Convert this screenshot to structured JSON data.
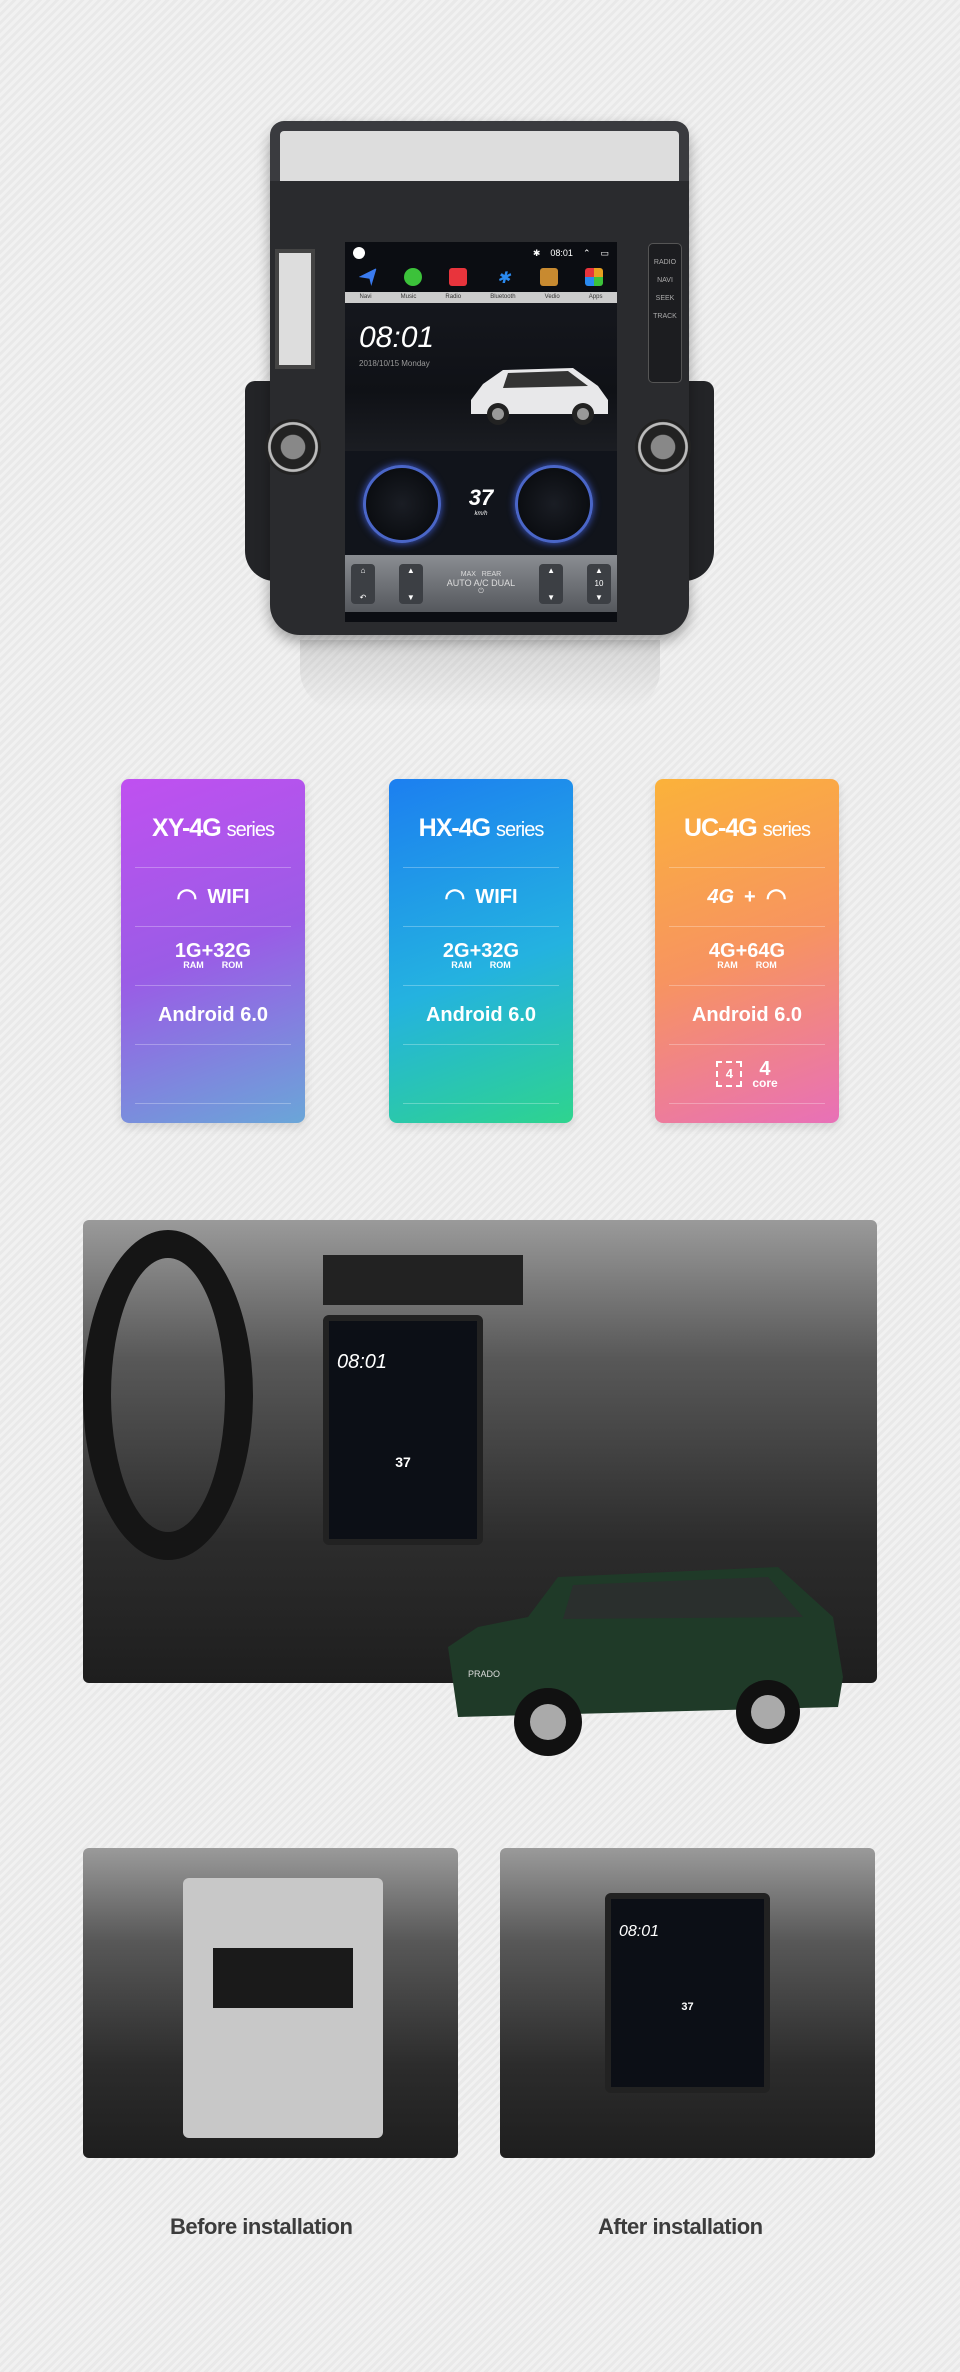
{
  "head_unit": {
    "side_buttons": [
      "RADIO",
      "NAVI",
      "SEEK",
      "TRACK"
    ],
    "status_time": "08:01",
    "apps": [
      {
        "label": "Navi",
        "color": "#3a7bf0"
      },
      {
        "label": "Music",
        "color": "#3cc23a"
      },
      {
        "label": "Radio",
        "color": "#e8343c"
      },
      {
        "label": "Bluetooth",
        "color": "#2a8af0"
      },
      {
        "label": "Vedio",
        "color": "#c88a30"
      },
      {
        "label": "Apps",
        "color": "#e8a020"
      }
    ],
    "clock": "08:01",
    "date": "2018/10/15 Monday",
    "speed": "37",
    "speed_unit": "km/h",
    "climate": {
      "rear": "REAR",
      "max": "MAX",
      "auto": "AUTO",
      "ac": "A/C",
      "dual": "DUAL",
      "volume": "10"
    }
  },
  "series_cards": [
    {
      "name": "XY-4G",
      "suffix": "series",
      "connectivity": "WIFI",
      "memory": "1G+32G",
      "ram": "RAM",
      "rom": "ROM",
      "os": "Android 6.0"
    },
    {
      "name": "HX-4G",
      "suffix": "series",
      "connectivity": "WIFI",
      "memory": "2G+32G",
      "ram": "RAM",
      "rom": "ROM",
      "os": "Android 6.0"
    },
    {
      "name": "UC-4G",
      "suffix": "series",
      "connectivity_4g": "4G",
      "plus": "+",
      "memory": "4G+64G",
      "ram": "RAM",
      "rom": "ROM",
      "os": "Android 6.0",
      "cores": "4",
      "cores_label": "core",
      "chip_num": "4"
    }
  ],
  "installed_photo": {
    "screen_clock": "08:01",
    "screen_speed": "37",
    "car_badge": "PRADO"
  },
  "comparison": {
    "before": "Before installation",
    "after": "After installation",
    "after_clock": "08:01",
    "after_speed": "37"
  }
}
